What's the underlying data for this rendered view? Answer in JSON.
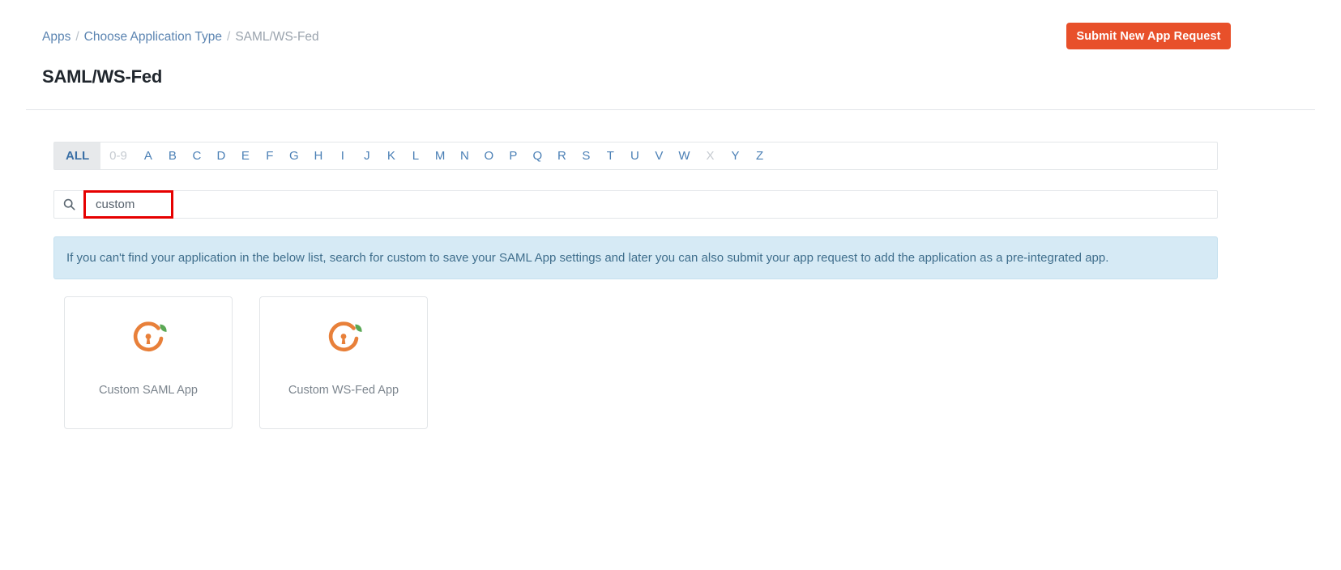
{
  "breadcrumb": {
    "items": [
      {
        "label": "Apps",
        "type": "link"
      },
      {
        "label": "Choose Application Type",
        "type": "link"
      },
      {
        "label": "SAML/WS-Fed",
        "type": "current"
      }
    ],
    "separator": "/"
  },
  "header": {
    "title": "SAML/WS-Fed",
    "submit_button_label": "Submit New App Request"
  },
  "alphabet_filter": {
    "items": [
      {
        "label": "ALL",
        "state": "active"
      },
      {
        "label": "0-9",
        "state": "disabled"
      },
      {
        "label": "A",
        "state": "enabled"
      },
      {
        "label": "B",
        "state": "enabled"
      },
      {
        "label": "C",
        "state": "enabled"
      },
      {
        "label": "D",
        "state": "enabled"
      },
      {
        "label": "E",
        "state": "enabled"
      },
      {
        "label": "F",
        "state": "enabled"
      },
      {
        "label": "G",
        "state": "enabled"
      },
      {
        "label": "H",
        "state": "enabled"
      },
      {
        "label": "I",
        "state": "enabled"
      },
      {
        "label": "J",
        "state": "enabled"
      },
      {
        "label": "K",
        "state": "enabled"
      },
      {
        "label": "L",
        "state": "enabled"
      },
      {
        "label": "M",
        "state": "enabled"
      },
      {
        "label": "N",
        "state": "enabled"
      },
      {
        "label": "O",
        "state": "enabled"
      },
      {
        "label": "P",
        "state": "enabled"
      },
      {
        "label": "Q",
        "state": "enabled"
      },
      {
        "label": "R",
        "state": "enabled"
      },
      {
        "label": "S",
        "state": "enabled"
      },
      {
        "label": "T",
        "state": "enabled"
      },
      {
        "label": "U",
        "state": "enabled"
      },
      {
        "label": "V",
        "state": "enabled"
      },
      {
        "label": "W",
        "state": "enabled"
      },
      {
        "label": "X",
        "state": "disabled"
      },
      {
        "label": "Y",
        "state": "enabled"
      },
      {
        "label": "Z",
        "state": "enabled"
      }
    ]
  },
  "search": {
    "icon": "search-icon",
    "value": "custom",
    "placeholder": ""
  },
  "info_banner": {
    "text": "If you can't find your application in the below list, search for custom to save your SAML App settings and later you can also submit your app request to add the application as a pre-integrated app."
  },
  "app_cards": [
    {
      "label": "Custom SAML App",
      "icon": "miniorange-lock-leaf-icon"
    },
    {
      "label": "Custom WS-Fed App",
      "icon": "miniorange-lock-leaf-icon"
    }
  ],
  "colors": {
    "accent_orange": "#e8502a",
    "link_blue": "#5b84b1",
    "banner_bg": "#d6eaf5",
    "banner_text": "#3f6e8c",
    "icon_orange": "#e8803a",
    "icon_green": "#5aa855",
    "highlight_red": "#e60000"
  }
}
